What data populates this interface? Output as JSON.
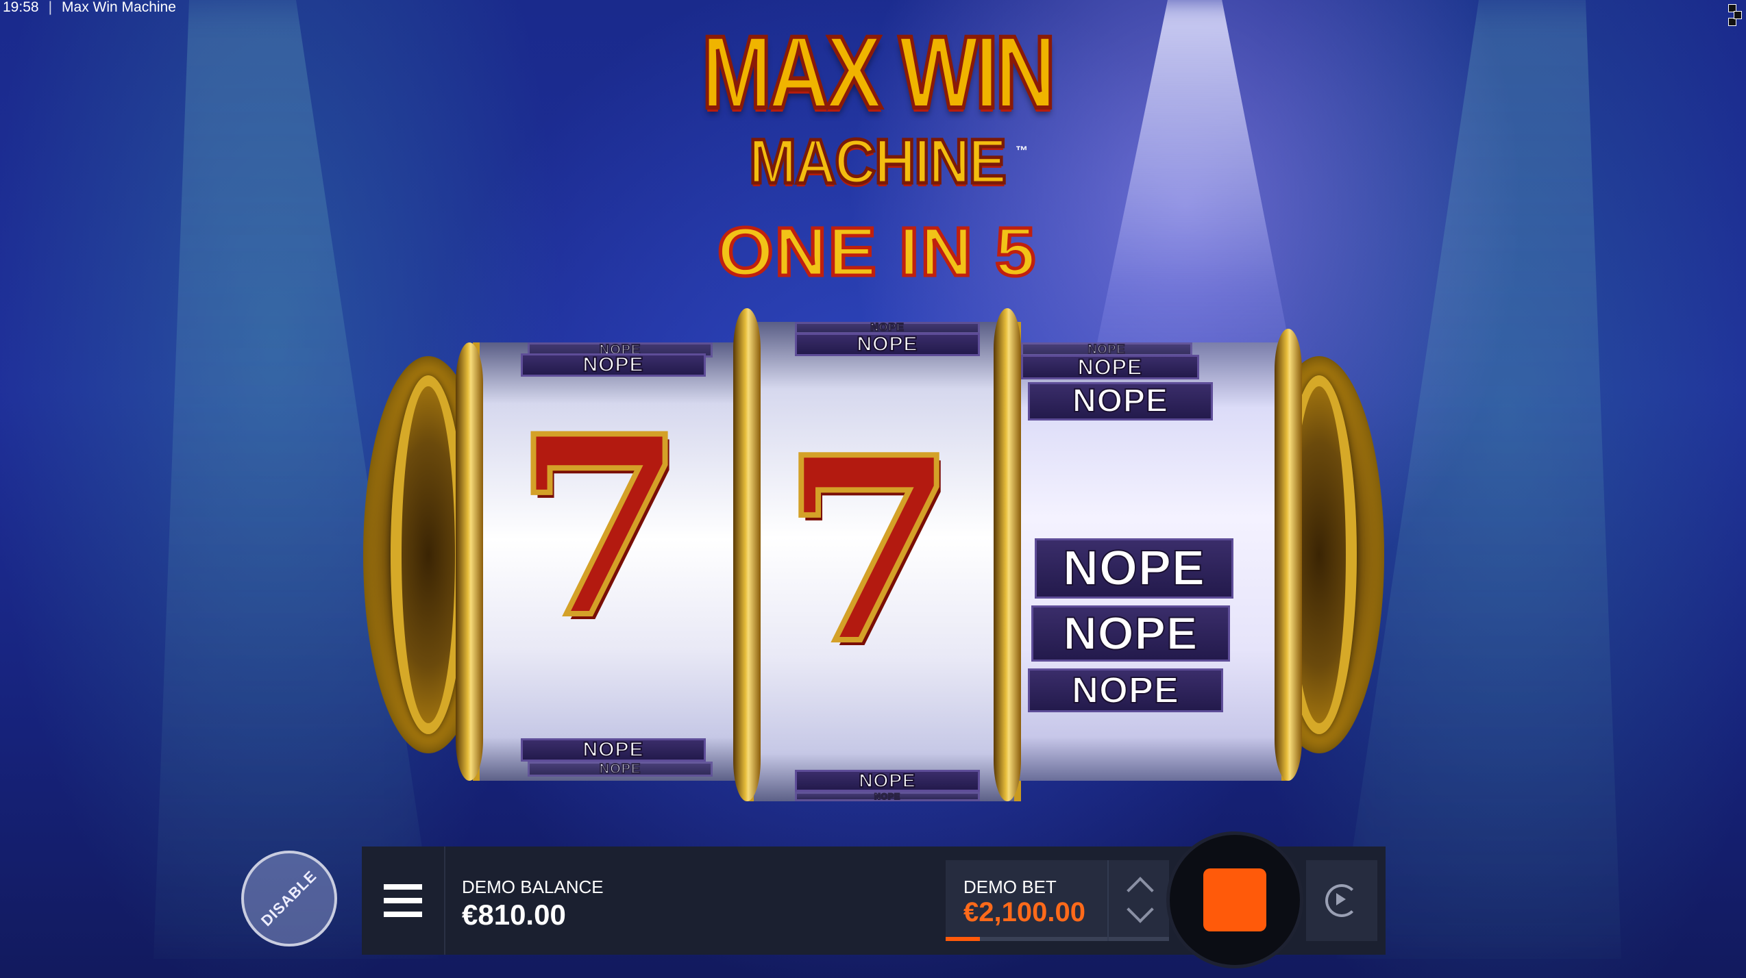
{
  "status_bar": {
    "time": "19:58",
    "separator": "|",
    "title": "Max Win Machine"
  },
  "logo": {
    "line1": "MAX WIN",
    "line2": "MACHINE",
    "trademark": "™",
    "tagline": "ONE IN 5"
  },
  "reels": {
    "reel1": {
      "top_symbols": [
        "NOPE",
        "NOPE"
      ],
      "center_symbol": "7",
      "bottom_symbols": [
        "NOPE",
        "NOPE"
      ]
    },
    "reel2": {
      "top_symbols": [
        "NOPE",
        "NOPE"
      ],
      "center_symbol": "7",
      "bottom_symbols": [
        "NOPE",
        "NOPE"
      ]
    },
    "reel3": {
      "top_symbols": [
        "NOPE",
        "NOPE",
        "NOPE"
      ],
      "center_symbols": [
        "NOPE",
        "NOPE",
        "NOPE"
      ]
    }
  },
  "controls": {
    "disable_label": "DISABLE",
    "balance_label": "DEMO BALANCE",
    "balance_value": "€810.00",
    "bet_label": "DEMO BET",
    "bet_value": "€2,100.00"
  },
  "colors": {
    "accent": "#ff5a0a",
    "bar_bg": "#1b2030",
    "bet_value": "#ff6a1a"
  }
}
